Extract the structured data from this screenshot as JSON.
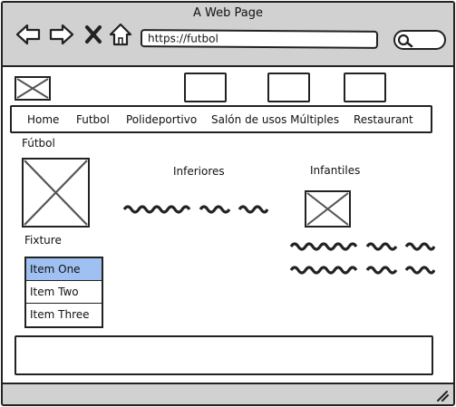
{
  "window": {
    "title": "A Web Page",
    "url": "https://futbol"
  },
  "toolbar": {
    "icons": [
      "back-arrow-icon",
      "forward-arrow-icon",
      "close-x-icon",
      "home-icon",
      "search-icon"
    ]
  },
  "menu": {
    "items": [
      {
        "label": "Home"
      },
      {
        "label": "Futbol"
      },
      {
        "label": "Polideportivo"
      },
      {
        "label": "Salón de usos Múltiples"
      },
      {
        "label": "Restaurant"
      }
    ]
  },
  "main": {
    "section_title": "Fútbol",
    "inferiores_title": "Inferiores",
    "infantiles_title": "Infantiles",
    "fixture_title": "Fixture",
    "fixture_list": [
      {
        "label": "Item One",
        "selected": true
      },
      {
        "label": "Item Two",
        "selected": false
      },
      {
        "label": "Item Three",
        "selected": false
      }
    ]
  },
  "colors": {
    "chrome": "#d1d1d1",
    "selection": "#9fc1f2",
    "stroke": "#222222"
  }
}
